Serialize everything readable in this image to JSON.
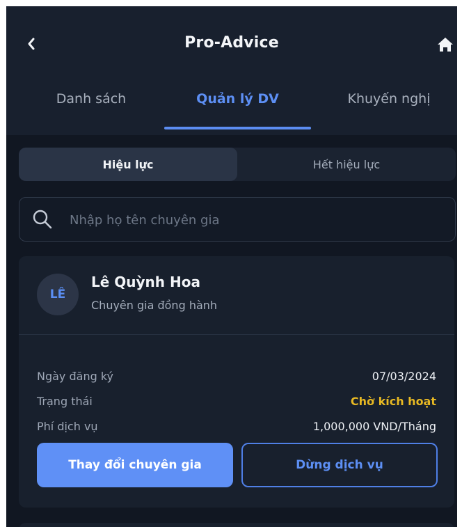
{
  "header": {
    "title": "Pro-Advice",
    "back_icon": "chevron-left-icon",
    "home_icon": "home-icon"
  },
  "tabs": [
    {
      "label": "Danh sách",
      "active": false
    },
    {
      "label": "Quản lý DV",
      "active": true
    },
    {
      "label": "Khuyến nghị",
      "active": false
    }
  ],
  "segmented": {
    "items": [
      {
        "label": "Hiệu lực",
        "active": true
      },
      {
        "label": "Hết hiệu lực",
        "active": false
      }
    ]
  },
  "search": {
    "placeholder": "Nhập họ tên chuyên gia",
    "value": "",
    "icon": "search-icon"
  },
  "card": {
    "avatar_text": "LÊ",
    "name": "Lê Quỳnh Hoa",
    "role": "Chuyên gia đồng hành",
    "fields": [
      {
        "label": "Ngày đăng ký",
        "value": "07/03/2024"
      },
      {
        "label": "Trạng thái",
        "value": "Chờ kích hoạt"
      },
      {
        "label": "Phí dịch vụ",
        "value": "1,000,000 VND/Tháng"
      }
    ],
    "buttons": {
      "change_expert": "Thay đổi chuyên gia",
      "stop_service": "Dừng dịch vụ"
    }
  },
  "colors": {
    "background": "#111722",
    "header": "#18202e",
    "accent": "#5c8df2",
    "status": "#e8b923"
  }
}
